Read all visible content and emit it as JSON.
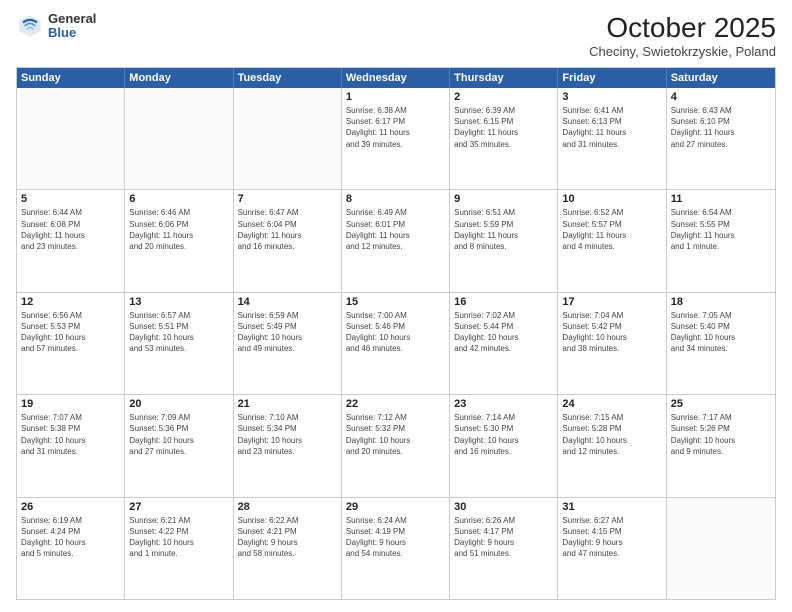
{
  "header": {
    "logo": {
      "general": "General",
      "blue": "Blue"
    },
    "title": "October 2025",
    "location": "Checiny, Swietokrzyskie, Poland"
  },
  "weekdays": [
    "Sunday",
    "Monday",
    "Tuesday",
    "Wednesday",
    "Thursday",
    "Friday",
    "Saturday"
  ],
  "rows": [
    [
      {
        "day": "",
        "info": ""
      },
      {
        "day": "",
        "info": ""
      },
      {
        "day": "",
        "info": ""
      },
      {
        "day": "1",
        "info": "Sunrise: 6:38 AM\nSunset: 6:17 PM\nDaylight: 11 hours\nand 39 minutes."
      },
      {
        "day": "2",
        "info": "Sunrise: 6:39 AM\nSunset: 6:15 PM\nDaylight: 11 hours\nand 35 minutes."
      },
      {
        "day": "3",
        "info": "Sunrise: 6:41 AM\nSunset: 6:13 PM\nDaylight: 11 hours\nand 31 minutes."
      },
      {
        "day": "4",
        "info": "Sunrise: 6:43 AM\nSunset: 6:10 PM\nDaylight: 11 hours\nand 27 minutes."
      }
    ],
    [
      {
        "day": "5",
        "info": "Sunrise: 6:44 AM\nSunset: 6:08 PM\nDaylight: 11 hours\nand 23 minutes."
      },
      {
        "day": "6",
        "info": "Sunrise: 6:46 AM\nSunset: 6:06 PM\nDaylight: 11 hours\nand 20 minutes."
      },
      {
        "day": "7",
        "info": "Sunrise: 6:47 AM\nSunset: 6:04 PM\nDaylight: 11 hours\nand 16 minutes."
      },
      {
        "day": "8",
        "info": "Sunrise: 6:49 AM\nSunset: 6:01 PM\nDaylight: 11 hours\nand 12 minutes."
      },
      {
        "day": "9",
        "info": "Sunrise: 6:51 AM\nSunset: 5:59 PM\nDaylight: 11 hours\nand 8 minutes."
      },
      {
        "day": "10",
        "info": "Sunrise: 6:52 AM\nSunset: 5:57 PM\nDaylight: 11 hours\nand 4 minutes."
      },
      {
        "day": "11",
        "info": "Sunrise: 6:54 AM\nSunset: 5:55 PM\nDaylight: 11 hours\nand 1 minute."
      }
    ],
    [
      {
        "day": "12",
        "info": "Sunrise: 6:56 AM\nSunset: 5:53 PM\nDaylight: 10 hours\nand 57 minutes."
      },
      {
        "day": "13",
        "info": "Sunrise: 6:57 AM\nSunset: 5:51 PM\nDaylight: 10 hours\nand 53 minutes."
      },
      {
        "day": "14",
        "info": "Sunrise: 6:59 AM\nSunset: 5:49 PM\nDaylight: 10 hours\nand 49 minutes."
      },
      {
        "day": "15",
        "info": "Sunrise: 7:00 AM\nSunset: 5:46 PM\nDaylight: 10 hours\nand 46 minutes."
      },
      {
        "day": "16",
        "info": "Sunrise: 7:02 AM\nSunset: 5:44 PM\nDaylight: 10 hours\nand 42 minutes."
      },
      {
        "day": "17",
        "info": "Sunrise: 7:04 AM\nSunset: 5:42 PM\nDaylight: 10 hours\nand 38 minutes."
      },
      {
        "day": "18",
        "info": "Sunrise: 7:05 AM\nSunset: 5:40 PM\nDaylight: 10 hours\nand 34 minutes."
      }
    ],
    [
      {
        "day": "19",
        "info": "Sunrise: 7:07 AM\nSunset: 5:38 PM\nDaylight: 10 hours\nand 31 minutes."
      },
      {
        "day": "20",
        "info": "Sunrise: 7:09 AM\nSunset: 5:36 PM\nDaylight: 10 hours\nand 27 minutes."
      },
      {
        "day": "21",
        "info": "Sunrise: 7:10 AM\nSunset: 5:34 PM\nDaylight: 10 hours\nand 23 minutes."
      },
      {
        "day": "22",
        "info": "Sunrise: 7:12 AM\nSunset: 5:32 PM\nDaylight: 10 hours\nand 20 minutes."
      },
      {
        "day": "23",
        "info": "Sunrise: 7:14 AM\nSunset: 5:30 PM\nDaylight: 10 hours\nand 16 minutes."
      },
      {
        "day": "24",
        "info": "Sunrise: 7:15 AM\nSunset: 5:28 PM\nDaylight: 10 hours\nand 12 minutes."
      },
      {
        "day": "25",
        "info": "Sunrise: 7:17 AM\nSunset: 5:26 PM\nDaylight: 10 hours\nand 9 minutes."
      }
    ],
    [
      {
        "day": "26",
        "info": "Sunrise: 6:19 AM\nSunset: 4:24 PM\nDaylight: 10 hours\nand 5 minutes."
      },
      {
        "day": "27",
        "info": "Sunrise: 6:21 AM\nSunset: 4:22 PM\nDaylight: 10 hours\nand 1 minute."
      },
      {
        "day": "28",
        "info": "Sunrise: 6:22 AM\nSunset: 4:21 PM\nDaylight: 9 hours\nand 58 minutes."
      },
      {
        "day": "29",
        "info": "Sunrise: 6:24 AM\nSunset: 4:19 PM\nDaylight: 9 hours\nand 54 minutes."
      },
      {
        "day": "30",
        "info": "Sunrise: 6:26 AM\nSunset: 4:17 PM\nDaylight: 9 hours\nand 51 minutes."
      },
      {
        "day": "31",
        "info": "Sunrise: 6:27 AM\nSunset: 4:15 PM\nDaylight: 9 hours\nand 47 minutes."
      },
      {
        "day": "",
        "info": ""
      }
    ]
  ]
}
